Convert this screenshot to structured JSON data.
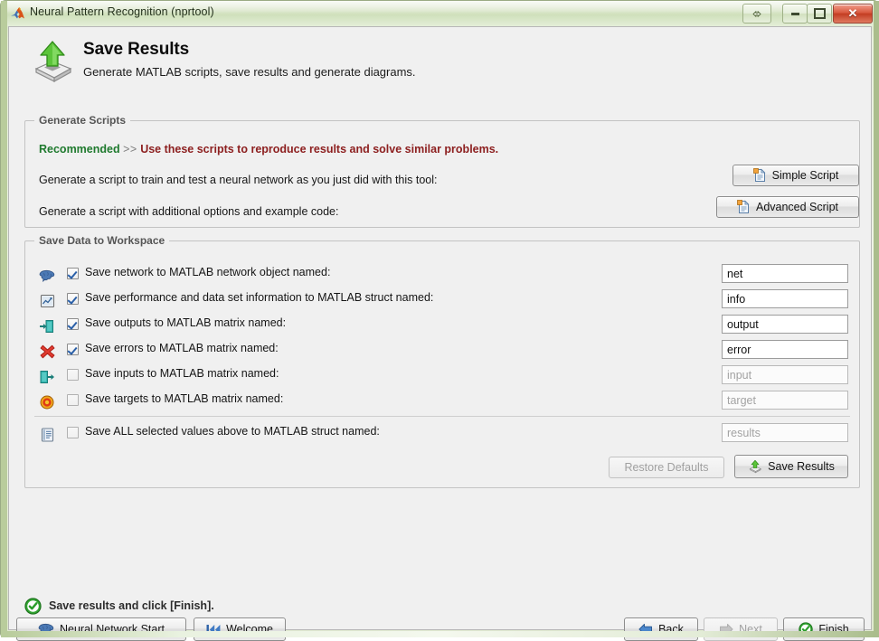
{
  "window": {
    "title": "Neural Pattern Recognition (nprtool)",
    "logo_icon": "matlab-membrane-icon",
    "controls": {
      "resize_icon": "resize-arrows-icon",
      "minimize_icon": "minimize-icon",
      "maximize_icon": "maximize-icon",
      "close_icon": "close-icon"
    }
  },
  "header": {
    "icon": "save-export-icon",
    "title": "Save Results",
    "subtitle": "Generate MATLAB scripts, save results and generate diagrams."
  },
  "generate_scripts": {
    "group_title": "Generate Scripts",
    "recommended_word": "Recommended",
    "recommended_arrow": ">>",
    "recommended_rest": "Use these scripts to reproduce results and solve similar problems.",
    "rows": [
      {
        "label": "Generate a script to train and test a neural network as you just did with this tool:",
        "button": "Simple Script",
        "button_icon": "script-document-icon"
      },
      {
        "label": "Generate a script with additional options and example code:",
        "button": "Advanced Script",
        "button_icon": "script-document-icon"
      }
    ]
  },
  "save_data": {
    "group_title": "Save Data to Workspace",
    "rows": [
      {
        "icon": "brain-icon",
        "checked": true,
        "label": "Save network to MATLAB network object named:",
        "value": "net",
        "enabled": true
      },
      {
        "icon": "report-icon",
        "checked": true,
        "label": "Save performance and data set information to MATLAB struct named:",
        "value": "info",
        "enabled": true
      },
      {
        "icon": "output-arrow-icon",
        "checked": true,
        "label": "Save outputs to MATLAB matrix named:",
        "value": "output",
        "enabled": true
      },
      {
        "icon": "red-x-icon",
        "checked": true,
        "label": "Save errors to MATLAB matrix named:",
        "value": "error",
        "enabled": true
      },
      {
        "icon": "input-arrow-icon",
        "checked": false,
        "label": "Save inputs to MATLAB matrix named:",
        "value": "input",
        "enabled": false
      },
      {
        "icon": "target-icon",
        "checked": false,
        "label": "Save targets to MATLAB matrix named:",
        "value": "target",
        "enabled": false
      }
    ],
    "save_all_row": {
      "icon": "struct-list-icon",
      "checked": false,
      "label": "Save ALL selected values above to MATLAB struct named:",
      "value": "results",
      "enabled": false
    },
    "restore_defaults": {
      "label": "Restore Defaults",
      "enabled": false
    },
    "save_results": {
      "label": "Save Results",
      "icon": "save-export-icon",
      "enabled": true
    }
  },
  "status": {
    "icon": "green-check-circle-icon",
    "text": "Save results and click [Finish]."
  },
  "nav": {
    "neural_network_start": {
      "label": "Neural Network Start",
      "icon": "brain-icon"
    },
    "welcome": {
      "label": "Welcome",
      "icon": "skip-to-start-icon"
    },
    "back": {
      "label": "Back",
      "icon": "arrow-left-icon",
      "enabled": true
    },
    "next": {
      "label": "Next",
      "icon": "arrow-right-icon",
      "enabled": false
    },
    "finish": {
      "label": "Finish",
      "icon": "green-check-circle-icon",
      "enabled": true
    }
  },
  "colors": {
    "recommended_green": "#1f7a2e",
    "recommended_red": "#8d2020",
    "window_green": "#cfe0bb",
    "close_red": "#c33d22",
    "accent_blue": "#2a5fa8"
  }
}
